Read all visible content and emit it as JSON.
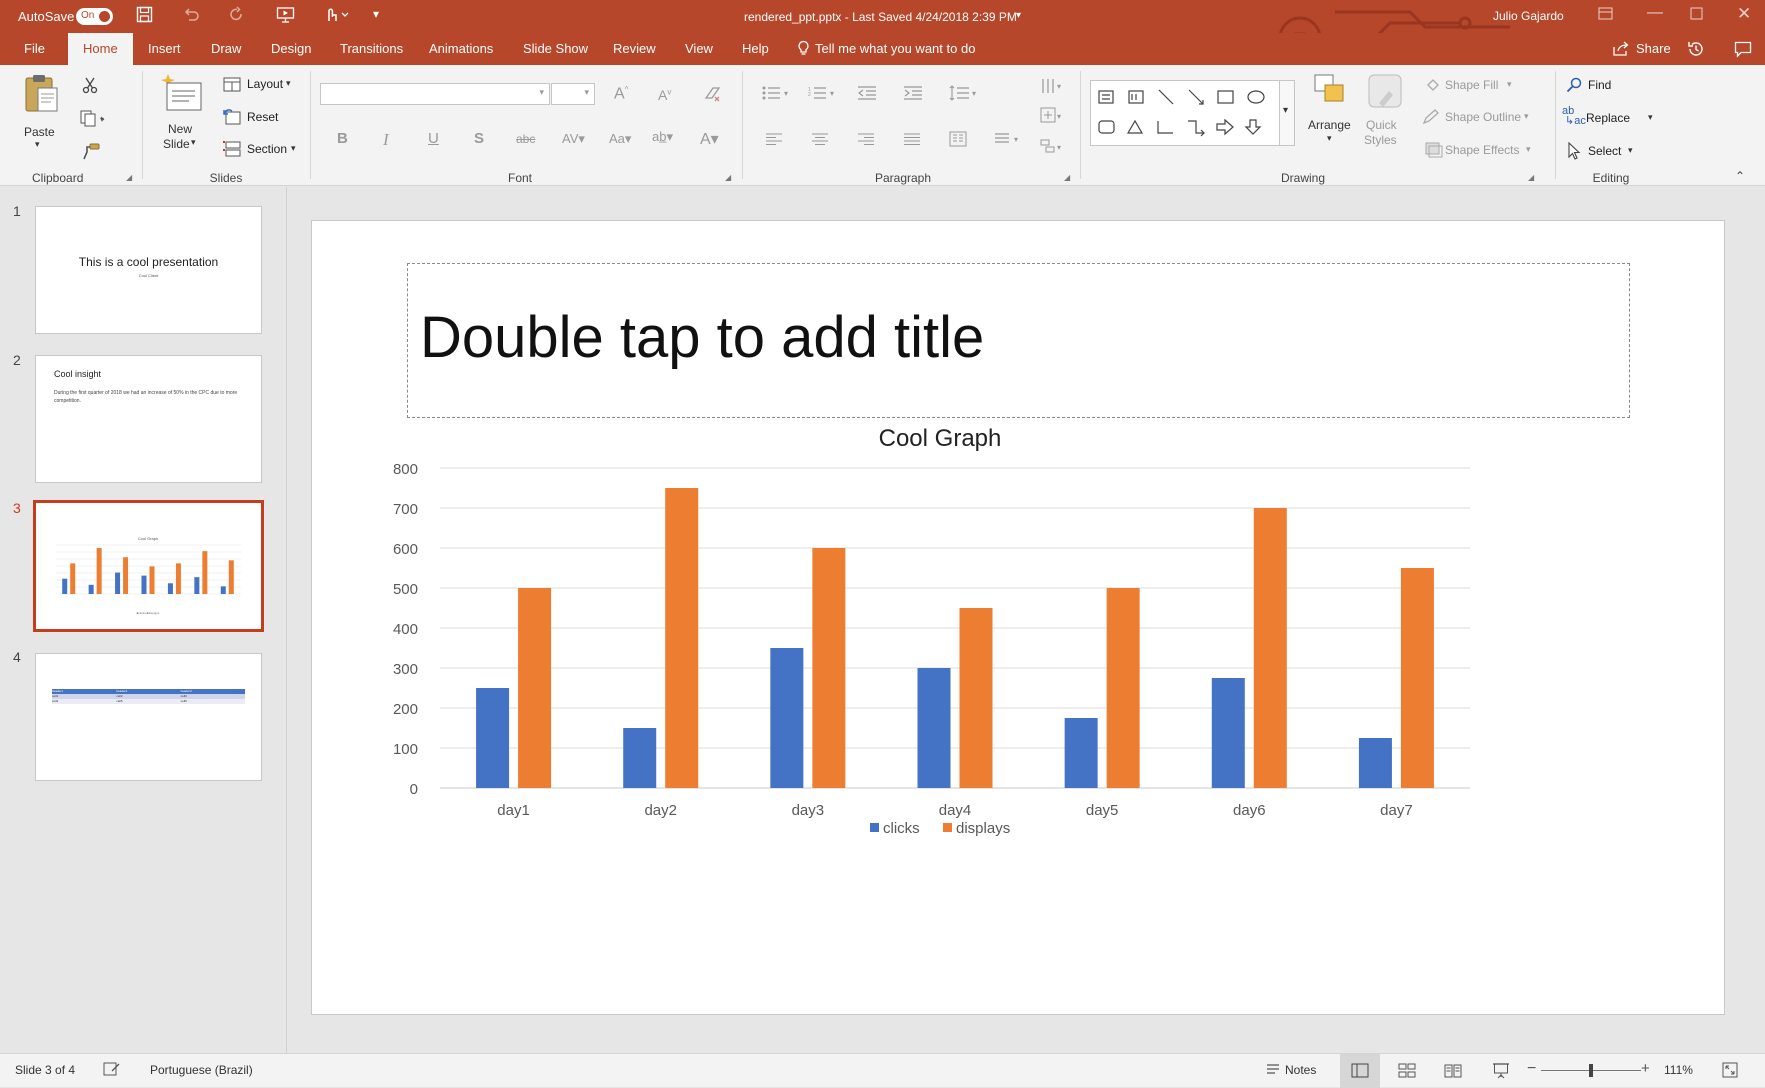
{
  "titlebar": {
    "autosave_label": "AutoSave",
    "autosave_state": "On",
    "document_title": "rendered_ppt.pptx  -  Last Saved 4/24/2018 2:39 PM",
    "user_name": "Julio Gajardo"
  },
  "tabs": [
    "File",
    "Home",
    "Insert",
    "Draw",
    "Design",
    "Transitions",
    "Animations",
    "Slide Show",
    "Review",
    "View",
    "Help"
  ],
  "tell_me": "Tell me what you want to do",
  "share_label": "Share",
  "ribbon": {
    "clipboard": {
      "paste": "Paste",
      "label": "Clipboard"
    },
    "slides": {
      "new_slide_1": "New",
      "new_slide_2": "Slide",
      "layout": "Layout",
      "reset": "Reset",
      "section": "Section",
      "label": "Slides"
    },
    "font": {
      "label": "Font"
    },
    "paragraph": {
      "label": "Paragraph"
    },
    "drawing": {
      "arrange": "Arrange",
      "quick_styles_1": "Quick",
      "quick_styles_2": "Styles",
      "shape_fill": "Shape Fill",
      "shape_outline": "Shape Outline",
      "shape_effects": "Shape Effects",
      "label": "Drawing"
    },
    "editing": {
      "find": "Find",
      "replace": "Replace",
      "select": "Select",
      "label": "Editing"
    }
  },
  "thumbnails": [
    {
      "num": "1",
      "title": "This is a cool presentation",
      "subtitle": "Cool Client"
    },
    {
      "num": "2",
      "title": "Cool insight",
      "body": "During the first quarter of 2018 we had an increase of 50% in the CPC due to more competition."
    },
    {
      "num": "3"
    },
    {
      "num": "4",
      "table_headers": [
        "header1",
        "header2",
        "header3"
      ],
      "table_rows": [
        [
          "cell1",
          "cell2",
          "cell3"
        ],
        [
          "cell4",
          "cell5",
          "cell6"
        ]
      ]
    }
  ],
  "slide": {
    "title_placeholder": "Double tap to add title"
  },
  "chart_data": {
    "type": "bar",
    "title": "Cool Graph",
    "categories": [
      "day1",
      "day2",
      "day3",
      "day4",
      "day5",
      "day6",
      "day7"
    ],
    "series": [
      {
        "name": "clicks",
        "values": [
          250,
          150,
          350,
          300,
          175,
          275,
          125
        ],
        "color": "#4472c4"
      },
      {
        "name": "displays",
        "values": [
          500,
          750,
          600,
          450,
          500,
          700,
          550
        ],
        "color": "#ed7d31"
      }
    ],
    "ylim": [
      0,
      800
    ],
    "yticks": [
      0,
      100,
      200,
      300,
      400,
      500,
      600,
      700,
      800
    ],
    "grid": true,
    "legend_position": "bottom"
  },
  "statusbar": {
    "slide_info": "Slide 3 of 4",
    "language": "Portuguese (Brazil)",
    "notes": "Notes",
    "zoom": "111%"
  }
}
